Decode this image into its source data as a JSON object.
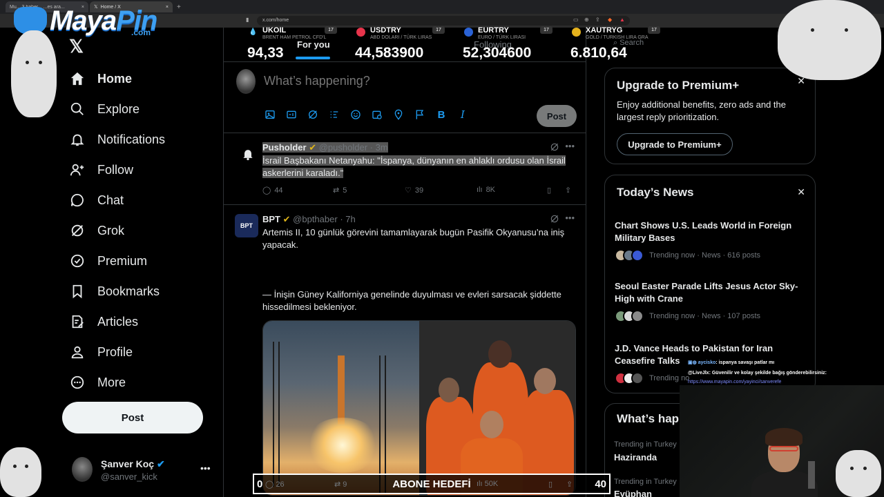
{
  "browser": {
    "tabs": [
      {
        "title": "Mu...  3 haber...  ...es ara..."
      },
      {
        "title": "Home / X"
      }
    ],
    "url": "x.com/home"
  },
  "overlay": {
    "logo_main": "Maya",
    "logo_accent": "Pin",
    "logo_suffix": ".com"
  },
  "ticker": [
    {
      "symbol": "UKOIL",
      "desc": "BRENT HAM PETROL CFD'L",
      "price": "94,33",
      "color": "#ffffff"
    },
    {
      "symbol": "USDTRY",
      "desc": "ABD DOLARI / TÜRK LIRAS",
      "price": "44,583900",
      "color": "#e8344b"
    },
    {
      "symbol": "EURTRY",
      "desc": "EURO / TÜRK LIRASI",
      "price": "52,304600",
      "color": "#2a62d6"
    },
    {
      "symbol": "XAUTRYG",
      "desc": "GOLD / TURKISH LIRA GRA",
      "price": "6.810,64",
      "color": "#e5b21d"
    }
  ],
  "ticker_badge": "17",
  "nav": {
    "items": [
      {
        "label": "Home"
      },
      {
        "label": "Explore"
      },
      {
        "label": "Notifications"
      },
      {
        "label": "Follow"
      },
      {
        "label": "Chat"
      },
      {
        "label": "Grok"
      },
      {
        "label": "Premium"
      },
      {
        "label": "Bookmarks"
      },
      {
        "label": "Articles"
      },
      {
        "label": "Profile"
      },
      {
        "label": "More"
      }
    ],
    "post_label": "Post",
    "account": {
      "name": "Şanver Koç",
      "handle": "@sanver_kick"
    }
  },
  "main": {
    "tabs": [
      {
        "label": "For you"
      },
      {
        "label": "Following"
      }
    ],
    "composer": {
      "placeholder": "What’s happening?",
      "post_label": "Post"
    },
    "tweets": [
      {
        "name": "Pusholder",
        "handle": "@pusholder",
        "time": "· 3m",
        "text": "İsrail Başbakanı Netanyahu: \"İspanya, dünyanın en ahlaklı ordusu olan İsrail askerlerini karaladı.\"",
        "replies": "44",
        "reposts": "5",
        "likes": "39",
        "views": "8K"
      },
      {
        "name": "BPT",
        "handle": "@bpthaber",
        "time": "· 7h",
        "avatar_text": "BPT",
        "text1": "Artemis II, 10 günlük görevini tamamlayarak bugün Pasifik Okyanusu’na iniş yapacak.",
        "text2": "— İnişin Güney Kaliforniya genelinde duyulması ve evleri sarsacak şiddette hissedilmesi bekleniyor.",
        "replies": "26",
        "reposts": "9",
        "views": "50K"
      }
    ]
  },
  "sidebar": {
    "search_hint": "Search",
    "premium": {
      "title": "Upgrade to Premium+",
      "desc": "Enjoy additional benefits, zero ads and the largest reply prioritization.",
      "button": "Upgrade to Premium+"
    },
    "news": {
      "title": "Today’s News",
      "items": [
        {
          "title": "Chart Shows U.S. Leads World in Foreign Military Bases",
          "meta": "Trending now · News · 616 posts"
        },
        {
          "title": "Seoul Easter Parade Lifts Jesus Actor Sky-High with Crane",
          "meta": "Trending now · News · 107 posts"
        },
        {
          "title": "J.D. Vance Heads to Pakistan for Iran Ceasefire Talks",
          "meta": "Trending no"
        }
      ]
    },
    "happening": {
      "title": "What’s hap",
      "trends": [
        {
          "context": "Trending in Turkey",
          "name": "Haziranda"
        },
        {
          "context": "Trending in Turkey",
          "name": "Eyüphan"
        }
      ]
    }
  },
  "stream": {
    "chat": [
      {
        "user": "aycisko",
        "message": ": ispanya savaşı patlar mı"
      },
      {
        "user": "@LiveJlx",
        "message": ": Güvenilir ve kolay şekilde bağış gönderebilirsiniz:"
      },
      {
        "user": "",
        "message": "https://www.mayapin.com/yayinci/sanverefe"
      }
    ],
    "goal": {
      "left": "0",
      "label": "ABONE HEDEFİ",
      "right": "40"
    }
  },
  "colors": {
    "accent": "#1d9bf0",
    "verified": "#1d9bf0",
    "gold": "#e2b719"
  }
}
